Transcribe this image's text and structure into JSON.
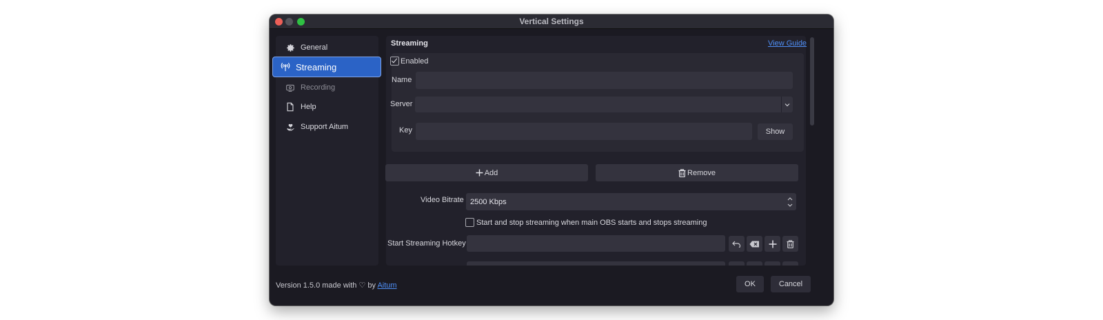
{
  "window": {
    "title": "Vertical Settings"
  },
  "sidebar": {
    "items": [
      {
        "label": "General",
        "icon": "gear-icon"
      },
      {
        "label": "Streaming",
        "icon": "antenna-icon",
        "active": true
      },
      {
        "label": "Recording",
        "icon": "recording-icon"
      },
      {
        "label": "Help",
        "icon": "document-icon"
      },
      {
        "label": "Support Aitum",
        "icon": "heart-hand-icon"
      }
    ]
  },
  "streaming": {
    "title": "Streaming",
    "view_guide": "View Guide",
    "enabled_label": "Enabled",
    "enabled": true,
    "name_label": "Name",
    "name_value": "",
    "server_label": "Server",
    "server_value": "",
    "key_label": "Key",
    "key_value": "",
    "show_label": "Show",
    "add_label": "Add",
    "remove_label": "Remove",
    "video_bitrate_label": "Video Bitrate",
    "video_bitrate_value": "2500 Kbps",
    "auto_start_label": "Start and stop streaming when main OBS starts and stops streaming",
    "auto_start_checked": false,
    "start_hotkey_label": "Start Streaming Hotkey",
    "start_hotkey_value": ""
  },
  "footer": {
    "version_text": "Version 1.5.0 made with ♡ by ",
    "link_text": "Aitum",
    "ok_label": "OK",
    "cancel_label": "Cancel"
  },
  "colors": {
    "accent": "#2b63c6",
    "link": "#4f8ff7",
    "background": "#1b1a22"
  }
}
